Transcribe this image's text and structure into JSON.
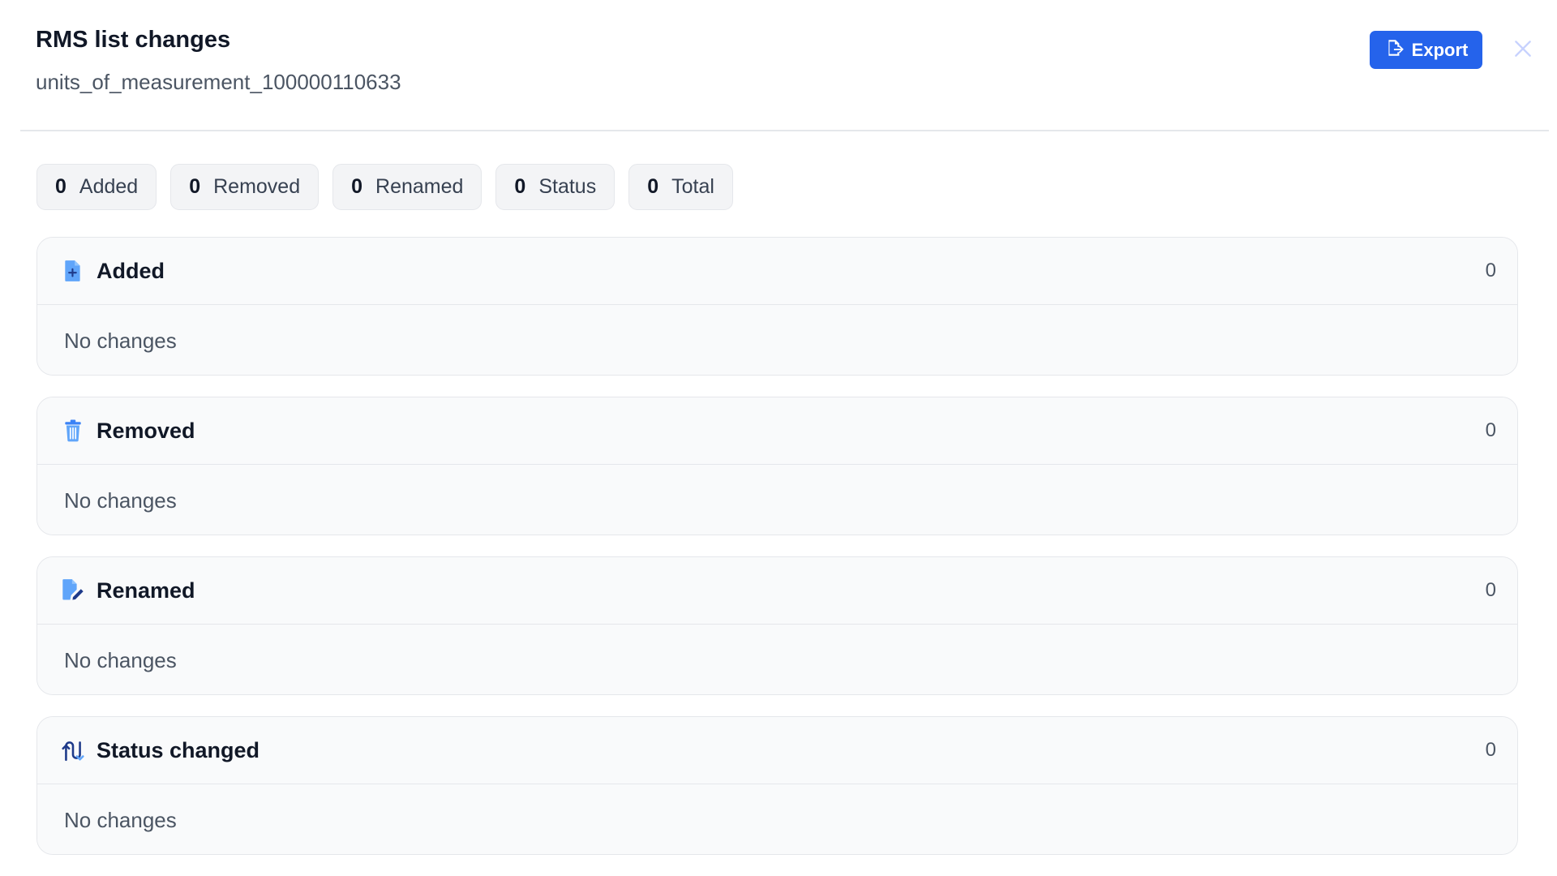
{
  "header": {
    "title": "RMS list changes",
    "subtitle": "units_of_measurement_100000110633",
    "export_label": "Export"
  },
  "summary": [
    {
      "count": "0",
      "label": "Added"
    },
    {
      "count": "0",
      "label": "Removed"
    },
    {
      "count": "0",
      "label": "Renamed"
    },
    {
      "count": "0",
      "label": "Status"
    },
    {
      "count": "0",
      "label": "Total"
    }
  ],
  "sections": [
    {
      "icon": "file-plus-icon",
      "title": "Added",
      "count": "0",
      "empty_text": "No changes"
    },
    {
      "icon": "trash-icon",
      "title": "Removed",
      "count": "0",
      "empty_text": "No changes"
    },
    {
      "icon": "file-edit-icon",
      "title": "Renamed",
      "count": "0",
      "empty_text": "No changes"
    },
    {
      "icon": "status-arrows-icon",
      "title": "Status changed",
      "count": "0",
      "empty_text": "No changes"
    }
  ],
  "colors": {
    "accent": "#2563eb",
    "icon": "#3b82f6",
    "border": "#e5e7eb",
    "muted_text": "#4b5563"
  }
}
